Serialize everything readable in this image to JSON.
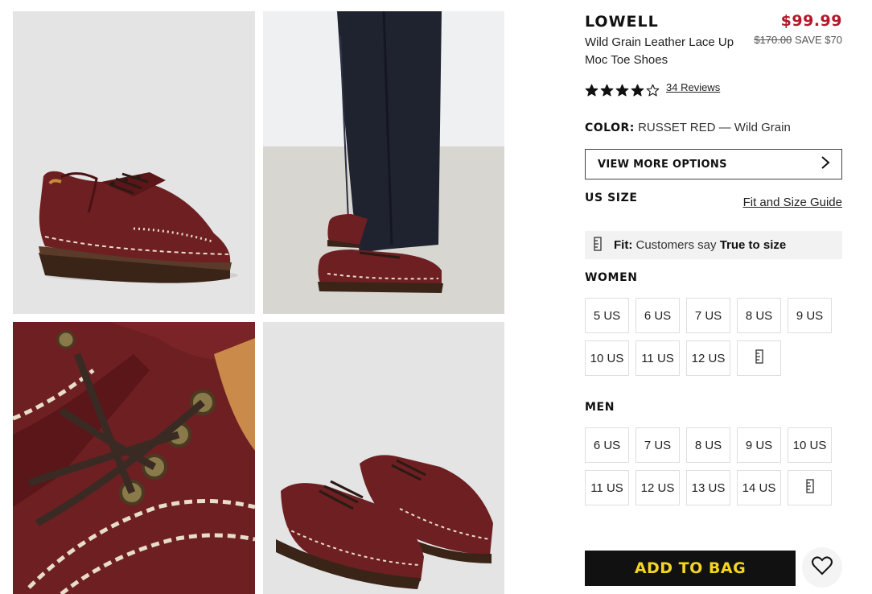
{
  "product": {
    "name": "LOWELL",
    "subtitle": "Wild Grain Leather Lace Up Moc Toe Shoes",
    "price": "$99.99",
    "original_price": "$170.00",
    "savings": "SAVE $70",
    "rating": 4,
    "rating_max": 5,
    "reviews_label": "34 Reviews"
  },
  "color": {
    "label": "COLOR:",
    "value": "RUSSET RED — Wild Grain"
  },
  "more_options_label": "VIEW MORE OPTIONS",
  "size": {
    "heading": "US SIZE",
    "guide_link": "Fit and Size Guide",
    "fit_label": "Fit:",
    "fit_text": "Customers say",
    "fit_value": "True to size"
  },
  "women": {
    "heading": "WOMEN",
    "sizes": [
      "5 US",
      "6 US",
      "7 US",
      "8 US",
      "9 US",
      "10 US",
      "11 US",
      "12 US"
    ]
  },
  "men": {
    "heading": "MEN",
    "sizes": [
      "6 US",
      "7 US",
      "8 US",
      "9 US",
      "10 US",
      "11 US",
      "12 US",
      "13 US",
      "14 US"
    ]
  },
  "add_to_bag_label": "ADD TO BAG",
  "colors": {
    "price_red": "#b5182a",
    "button_bg": "#111111",
    "button_text": "#f5d520",
    "leather": "#6e1f22"
  },
  "icons": {
    "chevron": "chevron-right-icon",
    "ruler": "ruler-icon",
    "wishlist": "heart-icon",
    "star": "star-icon"
  }
}
